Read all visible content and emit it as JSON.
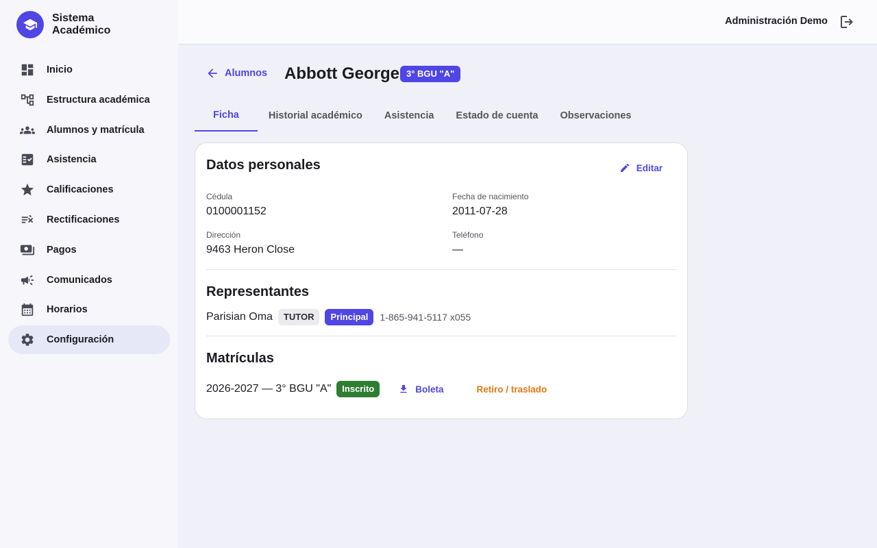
{
  "app": {
    "title_line1": "Sistema",
    "title_line2": "Académico",
    "logo_icon": "graduation-cap-icon"
  },
  "sidebar": {
    "items": [
      {
        "label": "Inicio",
        "icon": "dashboard-icon"
      },
      {
        "label": "Estructura académica",
        "icon": "hierarchy-icon"
      },
      {
        "label": "Alumnos y matrícula",
        "icon": "people-icon"
      },
      {
        "label": "Asistencia",
        "icon": "checklist-icon"
      },
      {
        "label": "Calificaciones",
        "icon": "star-icon"
      },
      {
        "label": "Rectificaciones",
        "icon": "rule-edit-icon"
      },
      {
        "label": "Pagos",
        "icon": "payments-icon"
      },
      {
        "label": "Comunicados",
        "icon": "megaphone-icon"
      },
      {
        "label": "Horarios",
        "icon": "calendar-icon"
      },
      {
        "label": "Configuración",
        "icon": "gear-icon",
        "active": true
      }
    ]
  },
  "topbar": {
    "user": "Administración Demo",
    "logout_icon": "logout-icon"
  },
  "header": {
    "back_label": "Alumnos",
    "student_name": "Abbott George",
    "grade_badge": "3° BGU \"A\""
  },
  "tabs": [
    {
      "label": "Ficha",
      "active": true
    },
    {
      "label": "Historial académico"
    },
    {
      "label": "Asistencia"
    },
    {
      "label": "Estado de cuenta"
    },
    {
      "label": "Observaciones"
    }
  ],
  "personal": {
    "title": "Datos personales",
    "edit_label": "Editar",
    "cedula_label": "Cédula",
    "cedula_value": "0100001152",
    "birth_label": "Fecha de nacimiento",
    "birth_value": "2011-07-28",
    "address_label": "Dirección",
    "address_value": "9463 Heron Close",
    "phone_label": "Teléfono",
    "phone_value": "—"
  },
  "representatives": {
    "title": "Representantes",
    "items": [
      {
        "name": "Parisian Oma",
        "role": "TUTOR",
        "principal": "Principal",
        "phone": "1-865-941-5117 x055"
      }
    ]
  },
  "enrollments": {
    "title": "Matrículas",
    "items": [
      {
        "label": "2026-2027 — 3° BGU \"A\"",
        "status": "Inscrito",
        "boleta_label": "Boleta",
        "retiro_label": "Retiro / traslado"
      }
    ]
  },
  "colors": {
    "primary": "#4f46e5",
    "success": "#2e7d32",
    "warning": "#e67712"
  }
}
